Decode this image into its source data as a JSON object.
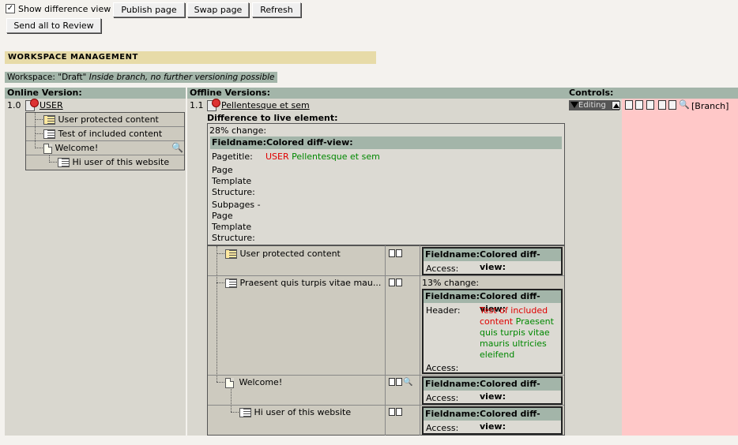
{
  "toolbar": {
    "show_diff_label": "Show difference view",
    "show_diff_checked": true,
    "publish_label": "Publish page",
    "swap_label": "Swap page",
    "refresh_label": "Refresh",
    "send_review_label": "Send all to Review"
  },
  "ws": {
    "title": "WORKSPACE MANAGEMENT",
    "workspace_prefix": "Workspace: \"Draft\"",
    "workspace_note": "Inside branch, no further versioning possible"
  },
  "columns": {
    "online": "Online Version:",
    "offline": "Offline Versions:",
    "controls": "Controls:"
  },
  "online": {
    "version": "1.0",
    "root_title": "USER",
    "items": [
      "User protected content",
      "Test of included content",
      "Welcome!",
      "Hi user of this website"
    ]
  },
  "offline": {
    "version": "1.1",
    "root_title": "Pellentesque et sem",
    "diff_heading": "Difference to live element:",
    "change_pct": "28% change:",
    "fieldname_label": "Fieldname:",
    "colored_label": "Colored diff-view:",
    "rows": [
      {
        "field": "Pagetitle:",
        "old": "USER",
        "new": "Pellentesque et sem"
      },
      {
        "field": "Page Template Structure:"
      },
      {
        "field": "Subpages - Page Template Structure:"
      }
    ],
    "sub": [
      {
        "title": "User protected content",
        "field": "Access:"
      },
      {
        "title": "Praesent quis turpis vitae mau...",
        "pct": "13% change:",
        "field1": "Header:",
        "old": "Test of included content",
        "new": "Praesent quis turpis vitae mauris ultricies eleifend",
        "field2": "Access:"
      },
      {
        "title": "Welcome!",
        "field": "Access:"
      },
      {
        "title": "Hi user of this website",
        "field": "Access:"
      }
    ]
  },
  "controls": {
    "stage": "Editing",
    "branch": "[Branch]"
  }
}
